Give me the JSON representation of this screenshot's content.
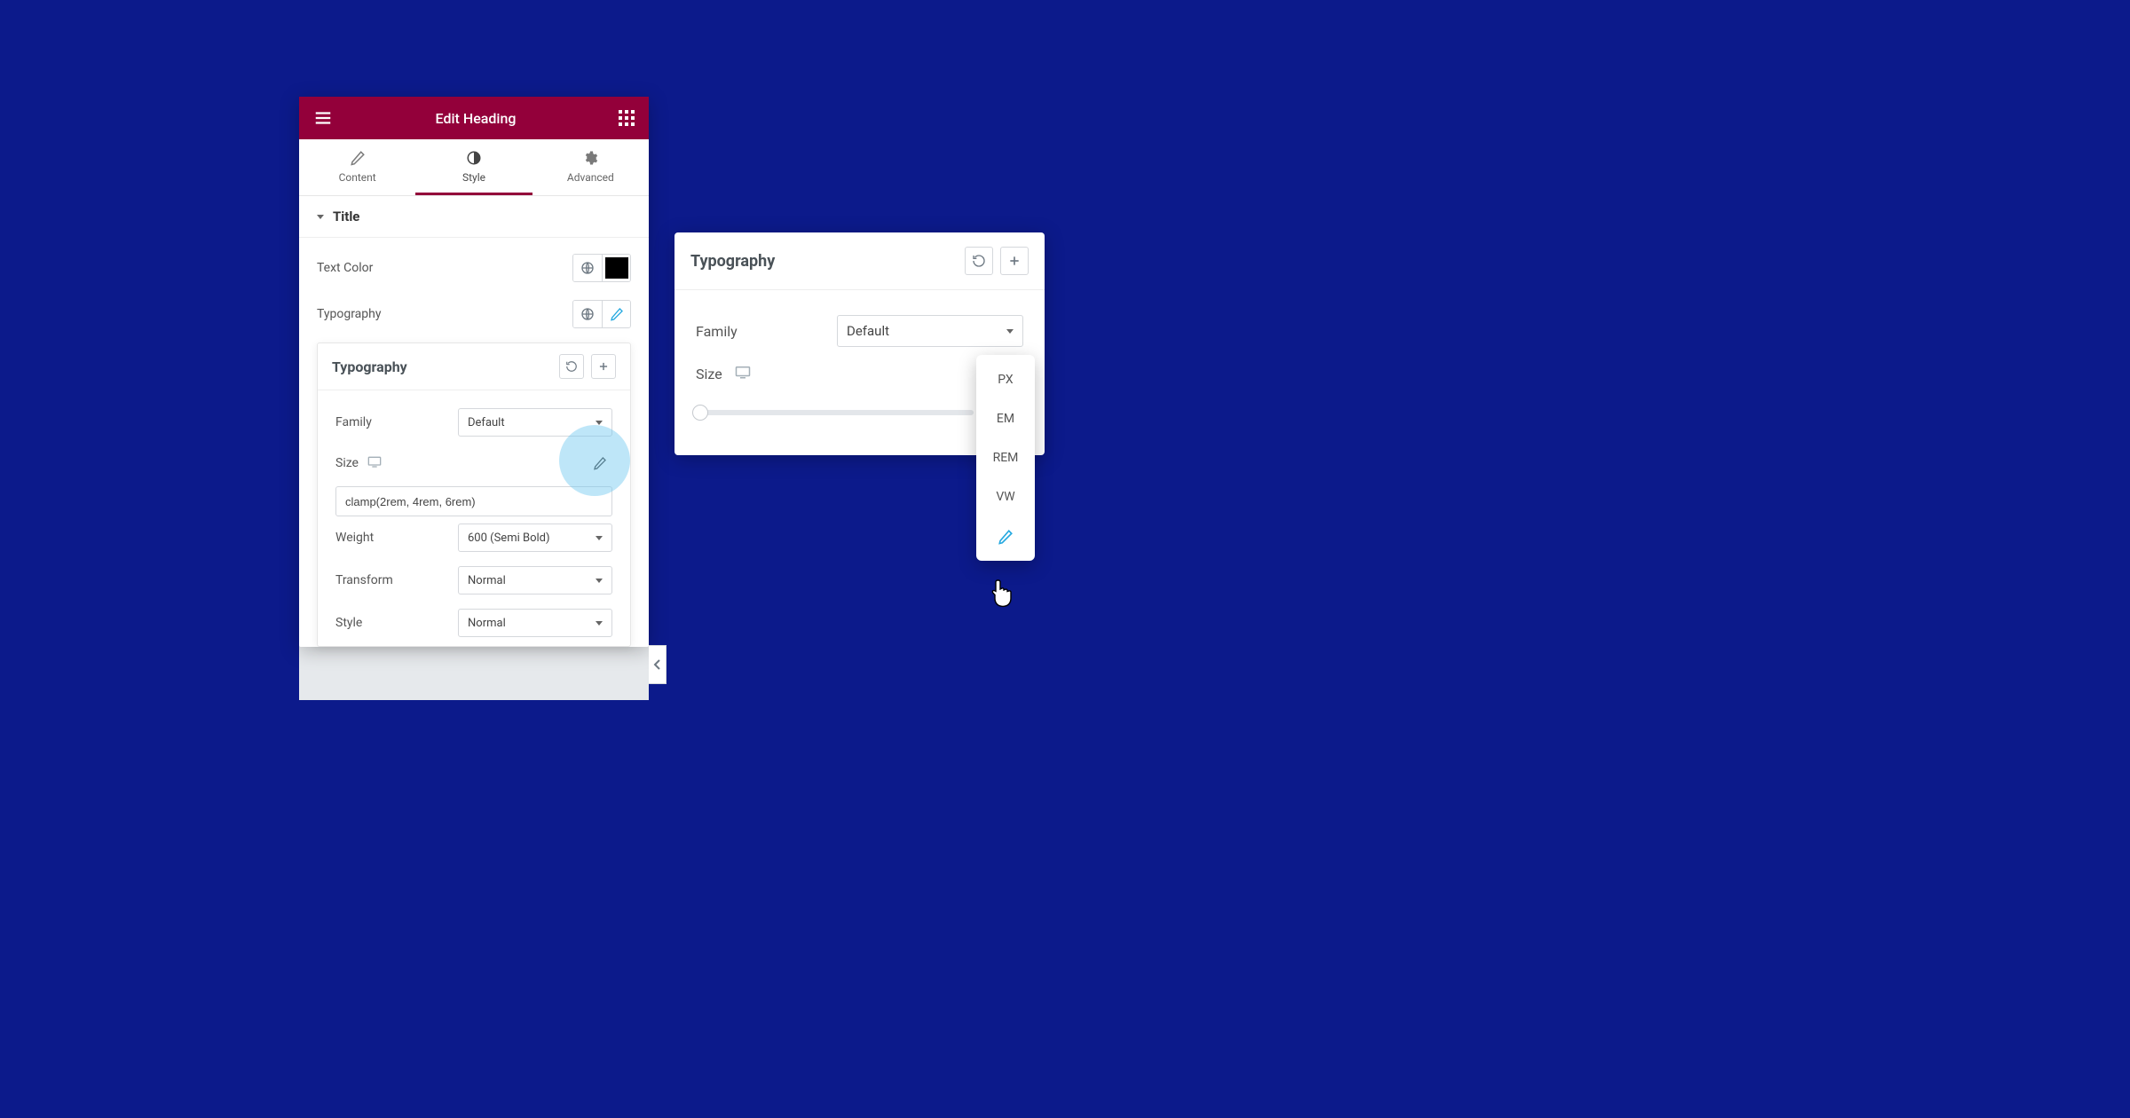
{
  "header": {
    "title": "Edit Heading"
  },
  "tabs": {
    "content": "Content",
    "style": "Style",
    "advanced": "Advanced"
  },
  "section": {
    "title": "Title"
  },
  "style": {
    "text_color_label": "Text Color",
    "typography_label": "Typography"
  },
  "typo_popover": {
    "title": "Typography",
    "family_label": "Family",
    "family_value": "Default",
    "size_label": "Size",
    "size_value": "clamp(2rem, 4rem, 6rem)",
    "weight_label": "Weight",
    "weight_value": "600 (Semi Bold)",
    "transform_label": "Transform",
    "transform_value": "Normal",
    "style_label": "Style",
    "style_value": "Normal"
  },
  "right_popover": {
    "title": "Typography",
    "family_label": "Family",
    "family_value": "Default",
    "size_label": "Size"
  },
  "unit_options": [
    "PX",
    "EM",
    "REM",
    "VW"
  ]
}
